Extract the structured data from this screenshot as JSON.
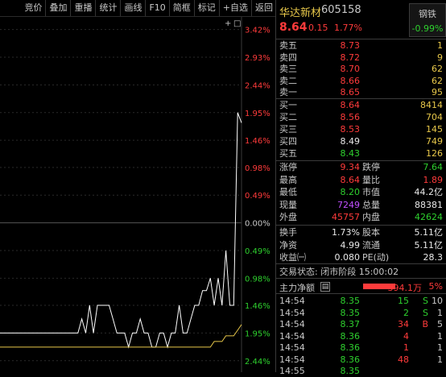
{
  "toolbar": [
    "竞价",
    "叠加",
    "重播",
    "统计",
    "画线",
    "F10",
    "简框",
    "标记",
    "+自选",
    "返回"
  ],
  "chart": {
    "y_labels_top": [
      "3.42%",
      "2.93%",
      "2.44%",
      "1.95%",
      "1.46%",
      "0.98%",
      "0.49%",
      "0.00%"
    ],
    "y_labels_bottom": [
      "0.49%",
      "0.98%",
      "1.46%",
      "1.95%",
      "2.44%"
    ],
    "zero_label": "0.00%",
    "zoom_icon": "+",
    "window_icon": "□"
  },
  "chart_data": {
    "type": "line",
    "series": [
      {
        "name": "price",
        "values": [
          -1.95,
          -1.95,
          -1.95,
          -1.95,
          -1.95,
          -1.95,
          -1.95,
          -1.95,
          -1.95,
          -1.95,
          -1.95,
          -1.95,
          -1.95,
          -1.95,
          -1.95,
          -1.95,
          -1.95,
          -1.95,
          -1.95,
          -1.95,
          -1.95,
          -1.7,
          -1.95,
          -1.46,
          -1.95,
          -1.46,
          -1.46,
          -1.46,
          -1.46,
          -1.7,
          -1.95,
          -1.95,
          -1.95,
          -2.2,
          -1.95,
          -1.95,
          -1.7,
          -1.95,
          -1.95,
          -2.2,
          -2.2,
          -1.95,
          -1.95,
          -2.2,
          -1.95,
          -1.95,
          -1.46,
          -1.95,
          -1.95,
          -1.7,
          -1.46,
          -1.46,
          -1.2,
          -1.2,
          -0.98,
          -1.46,
          -0.98,
          -1.46,
          -0.49,
          -1.46,
          -1.46,
          1.95,
          1.77
        ]
      },
      {
        "name": "avg",
        "values": [
          -2.2,
          -2.2,
          -2.2,
          -2.2,
          -2.2,
          -2.2,
          -2.2,
          -2.2,
          -2.2,
          -2.2,
          -2.2,
          -2.2,
          -2.2,
          -2.2,
          -2.2,
          -2.2,
          -2.2,
          -2.2,
          -2.2,
          -2.2,
          -2.2,
          -2.2,
          -2.2,
          -2.2,
          -2.2,
          -2.2,
          -2.2,
          -2.2,
          -2.2,
          -2.2,
          -2.2,
          -2.2,
          -2.2,
          -2.2,
          -2.2,
          -2.2,
          -2.2,
          -2.2,
          -2.2,
          -2.2,
          -2.2,
          -2.2,
          -2.2,
          -2.2,
          -2.2,
          -2.2,
          -2.2,
          -2.2,
          -2.2,
          -2.2,
          -2.2,
          -2.2,
          -2.2,
          -2.2,
          -2.2,
          -2.1,
          -2.1,
          -2.1,
          -2.0,
          -2.0,
          -2.0,
          -1.9,
          -1.8
        ]
      }
    ],
    "ylim": [
      -2.6,
      3.5
    ],
    "colors": {
      "price": "#ffffff",
      "avg": "#e8c84a",
      "zero": "#666666",
      "up": "#ff3b3b",
      "down": "#2ed02e"
    }
  },
  "stock": {
    "name": "华达新材",
    "code": "605158",
    "price": "8.64",
    "change": "0.15",
    "change_pct": "1.77%"
  },
  "industry": {
    "name": "钢铁",
    "change": "-0.99%"
  },
  "asks": [
    {
      "label": "卖五",
      "price": "8.73",
      "vol": "1"
    },
    {
      "label": "卖四",
      "price": "8.72",
      "vol": "9"
    },
    {
      "label": "卖三",
      "price": "8.70",
      "vol": "62"
    },
    {
      "label": "卖二",
      "price": "8.66",
      "vol": "62"
    },
    {
      "label": "卖一",
      "price": "8.65",
      "vol": "95"
    }
  ],
  "bids": [
    {
      "label": "买一",
      "price": "8.64",
      "vol": "8414",
      "color": "red"
    },
    {
      "label": "买二",
      "price": "8.56",
      "vol": "704",
      "color": "red"
    },
    {
      "label": "买三",
      "price": "8.53",
      "vol": "145",
      "color": "red"
    },
    {
      "label": "买四",
      "price": "8.49",
      "vol": "749",
      "color": "white"
    },
    {
      "label": "买五",
      "price": "8.43",
      "vol": "126",
      "color": "green"
    }
  ],
  "stats": [
    {
      "l1": "涨停",
      "v1": "9.34",
      "c1": "red",
      "l2": "跌停",
      "v2": "7.64",
      "c2": "green"
    },
    {
      "l1": "最高",
      "v1": "8.64",
      "c1": "red",
      "l2": "量比",
      "v2": "1.89",
      "c2": "red"
    },
    {
      "l1": "最低",
      "v1": "8.20",
      "c1": "green",
      "l2": "市值",
      "v2": "44.2亿",
      "c2": "white"
    },
    {
      "l1": "现量",
      "v1": "7249",
      "c1": "purple",
      "l2": "总量",
      "v2": "88381",
      "c2": "white"
    },
    {
      "l1": "外盘",
      "v1": "45757",
      "c1": "red",
      "l2": "内盘",
      "v2": "42624",
      "c2": "green"
    }
  ],
  "stats2": [
    {
      "l1": "换手",
      "v1": "1.73%",
      "l2": "股本",
      "v2": "5.11亿"
    },
    {
      "l1": "净资",
      "v1": "4.99",
      "l2": "流通",
      "v2": "5.11亿"
    },
    {
      "l1": "收益㈠",
      "v1": "0.080",
      "l2": "PE(动)",
      "v2": "28.3"
    }
  ],
  "status": "交易状态: 闭市阶段 15:00:02",
  "flow": {
    "label": "主力净额",
    "icon": "bar-chart-icon",
    "value": "394.1万",
    "pct": "5%"
  },
  "ticks": [
    {
      "time": "14:54",
      "price": "8.35",
      "vol": "15",
      "dir": "S",
      "cnt": "10",
      "vcol": "green"
    },
    {
      "time": "14:54",
      "price": "8.35",
      "vol": "2",
      "dir": "S",
      "cnt": "1",
      "vcol": "green"
    },
    {
      "time": "14:54",
      "price": "8.37",
      "vol": "34",
      "dir": "B",
      "cnt": "5",
      "vcol": "red"
    },
    {
      "time": "14:54",
      "price": "8.36",
      "vol": "4",
      "dir": "",
      "cnt": "1",
      "vcol": "red"
    },
    {
      "time": "14:54",
      "price": "8.36",
      "vol": "1",
      "dir": "",
      "cnt": "1",
      "vcol": "red"
    },
    {
      "time": "14:54",
      "price": "8.36",
      "vol": "48",
      "dir": "",
      "cnt": "1",
      "vcol": "red"
    },
    {
      "time": "14:55",
      "price": "8.35",
      "vol": "",
      "dir": "",
      "cnt": "",
      "vcol": "red"
    }
  ]
}
